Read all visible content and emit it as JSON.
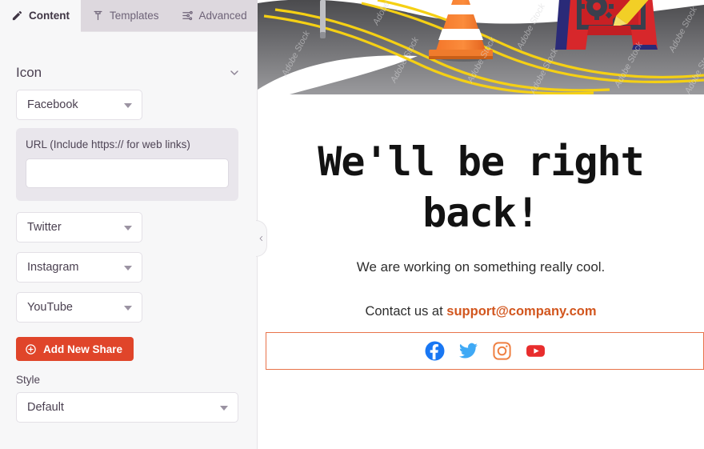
{
  "panel": {
    "tabs": [
      {
        "label": "Content",
        "icon": "pencil-icon",
        "active": true
      },
      {
        "label": "Templates",
        "icon": "stamp-icon",
        "active": false
      },
      {
        "label": "Advanced",
        "icon": "sliders-icon",
        "active": false
      }
    ],
    "section": {
      "title": "Icon",
      "toggle_icon": "chevron-down-icon"
    },
    "network_selects": [
      {
        "value": "Facebook"
      },
      {
        "value": "Twitter"
      },
      {
        "value": "Instagram"
      },
      {
        "value": "YouTube"
      }
    ],
    "url_field": {
      "label": "URL (Include https:// for web links)",
      "value": "",
      "placeholder": ""
    },
    "add_button": {
      "label": "Add New Share",
      "icon": "plus-circle-icon",
      "color": "#e0452a"
    },
    "style_field": {
      "label": "Style",
      "value": "Default"
    },
    "collapse_handle_icon": "chevron-left-icon"
  },
  "canvas": {
    "hero_alt": "road construction scene with traffic cone and warning sign",
    "hero_watermark": "Adobe Stock",
    "headline": "We'll be right back!",
    "subtext": "We are working on something really cool.",
    "contact_prefix": "Contact us at ",
    "contact_email": "support@company.com",
    "selection_color": "#e8734a",
    "social_icons": [
      {
        "name": "facebook-icon",
        "color": "#1977f3"
      },
      {
        "name": "twitter-icon",
        "color": "#3fa9f5"
      },
      {
        "name": "instagram-icon",
        "color": "#ef7f41"
      },
      {
        "name": "youtube-icon",
        "color": "#e82d2d"
      }
    ]
  }
}
